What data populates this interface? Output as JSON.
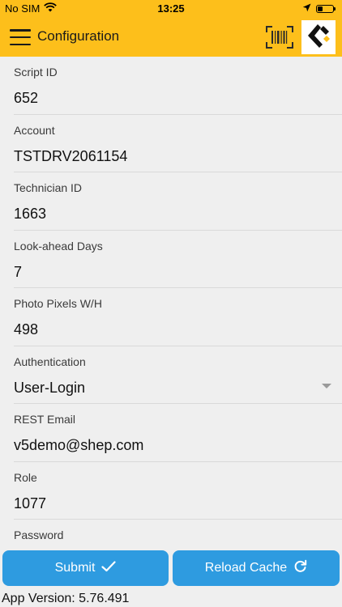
{
  "status_bar": {
    "carrier": "No SIM",
    "time": "13:25",
    "battery_level": 0.3
  },
  "header": {
    "title": "Configuration",
    "menu_icon": "hamburger-menu-icon",
    "barcode_icon": "barcode-scan-icon",
    "logo_icon": "company-logo-icon",
    "accent_color": "#fdbf1b"
  },
  "fields": [
    {
      "label": "Script ID",
      "value": "652"
    },
    {
      "label": "Account",
      "value": "TSTDRV2061154"
    },
    {
      "label": "Technician ID",
      "value": "1663"
    },
    {
      "label": "Look-ahead Days",
      "value": "7"
    },
    {
      "label": "Photo Pixels W/H",
      "value": "498"
    },
    {
      "label": "Authentication",
      "value": "User-Login"
    },
    {
      "label": "REST Email",
      "value": "v5demo@shep.com"
    },
    {
      "label": "Role",
      "value": "1077"
    },
    {
      "label": "Password",
      "value": ""
    }
  ],
  "buttons": {
    "submit_label": "Submit",
    "reload_label": "Reload Cache",
    "color": "#2e9be0"
  },
  "footer": {
    "app_version": "App Version: 5.76.491"
  }
}
